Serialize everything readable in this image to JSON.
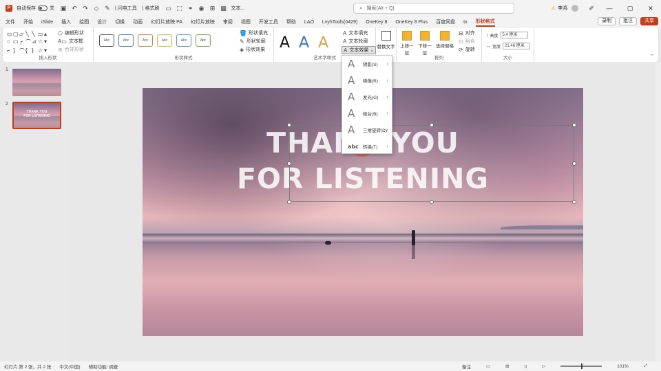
{
  "titlebar": {
    "autosave_label": "自动保存",
    "autosave_state": "关",
    "quick_items": [
      "自选形状",
      "| 闪电工具",
      "| 格式刷"
    ],
    "doc_name": "文本...",
    "search_placeholder": "搜索(Alt + Q)",
    "user_label": "李鸿",
    "warning_icon": "warning-icon"
  },
  "tabs": [
    "文件",
    "开始",
    "iSlide",
    "插入",
    "绘图",
    "设计",
    "切换",
    "动画",
    "幻灯片放映 PA",
    "幻灯片放映",
    "审阅",
    "视图",
    "开发工具",
    "帮助",
    "LAO",
    "LvyhTools(0429)",
    "OneKey 8",
    "OneKey 8 Plus",
    "百度网盘",
    "tx",
    "形状格式"
  ],
  "active_tab": "形状格式",
  "tab_actions": {
    "record": "录制",
    "comment": "批注",
    "share": "共享"
  },
  "ribbon": {
    "insert_shapes": {
      "label": "插入形状",
      "cmds": [
        "编辑形状",
        "文本框",
        "合并形状"
      ]
    },
    "shape_styles": {
      "label": "形状样式",
      "sample": "Abc",
      "cmds": [
        "形状填充",
        "形状轮廓",
        "形状效果"
      ],
      "border_colors": [
        "#555555",
        "#4a7fc1",
        "#e07b39",
        "#e0b340",
        "#5b9bd5",
        "#70ad47"
      ]
    },
    "wordart": {
      "label": "艺术字样式",
      "letters": [
        "A",
        "A",
        "A"
      ],
      "letter_colors": [
        "#111111",
        "#3a78c2",
        "#e3a14a"
      ],
      "cmds": [
        "文本填充",
        "文本轮廓",
        "文本效果"
      ]
    },
    "accessibility": {
      "label": "替换文字"
    },
    "arrange": {
      "label": "排列",
      "items": [
        "上移一层",
        "下移一层",
        "选择窗格"
      ],
      "cmds": [
        "对齐",
        "组合",
        "旋转"
      ]
    },
    "size": {
      "label": "大小",
      "height_label": "高度",
      "height_value": "5.4 厘米",
      "width_label": "宽度",
      "width_value": "21.46 厘米"
    }
  },
  "thumbnails": [
    {
      "number": "1",
      "line1": "",
      "line2": ""
    },
    {
      "number": "2",
      "line1": "THANK YOU",
      "line2": "FOR LISTENING"
    }
  ],
  "slide": {
    "title_line1": "THANK YOU",
    "title_line2": "FOR LISTENING"
  },
  "text_effects_menu": {
    "items": [
      {
        "label": "阴影(S)",
        "icon": "shadow-icon"
      },
      {
        "label": "映像(R)",
        "icon": "reflection-icon"
      },
      {
        "label": "发光(G)",
        "icon": "glow-icon"
      },
      {
        "label": "棱台(B)",
        "icon": "bevel-icon"
      },
      {
        "label": "三维旋转(D)",
        "icon": "3d-rotation-icon"
      },
      {
        "label": "转换(T)",
        "icon": "transform-icon"
      }
    ]
  },
  "statusbar": {
    "slide_info": "幻灯片 第 2 张，共 2 张",
    "language": "中文(中国)",
    "accessibility": "辅助功能: 调查",
    "notes": "备注",
    "zoom": "101%"
  }
}
